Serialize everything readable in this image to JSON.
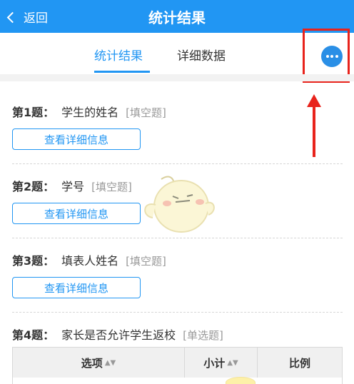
{
  "header": {
    "back_label": "返回",
    "title": "统计结果"
  },
  "tabs": [
    {
      "label": "统计结果",
      "active": true
    },
    {
      "label": "详细数据",
      "active": false
    }
  ],
  "more_icon": "more-horizontal-icon",
  "accent_color": "#2196f3",
  "annotation_color": "#e8231c",
  "questions": [
    {
      "num": "第1题：",
      "text": "学生的姓名",
      "type": "[填空题]",
      "button": "查看详细信息"
    },
    {
      "num": "第2题：",
      "text": "学号",
      "type": "[填空题]",
      "button": "查看详细信息"
    },
    {
      "num": "第3题：",
      "text": "填表人姓名",
      "type": "[填空题]",
      "button": "查看详细信息"
    },
    {
      "num": "第4题：",
      "text": "家长是否允许学生返校",
      "type": "[单选题]"
    }
  ],
  "table": {
    "columns": [
      {
        "label": "选项",
        "sortable": true
      },
      {
        "label": "小计",
        "sortable": true
      },
      {
        "label": "比例",
        "sortable": false
      }
    ],
    "sort_icon": "sort-arrows-icon"
  }
}
